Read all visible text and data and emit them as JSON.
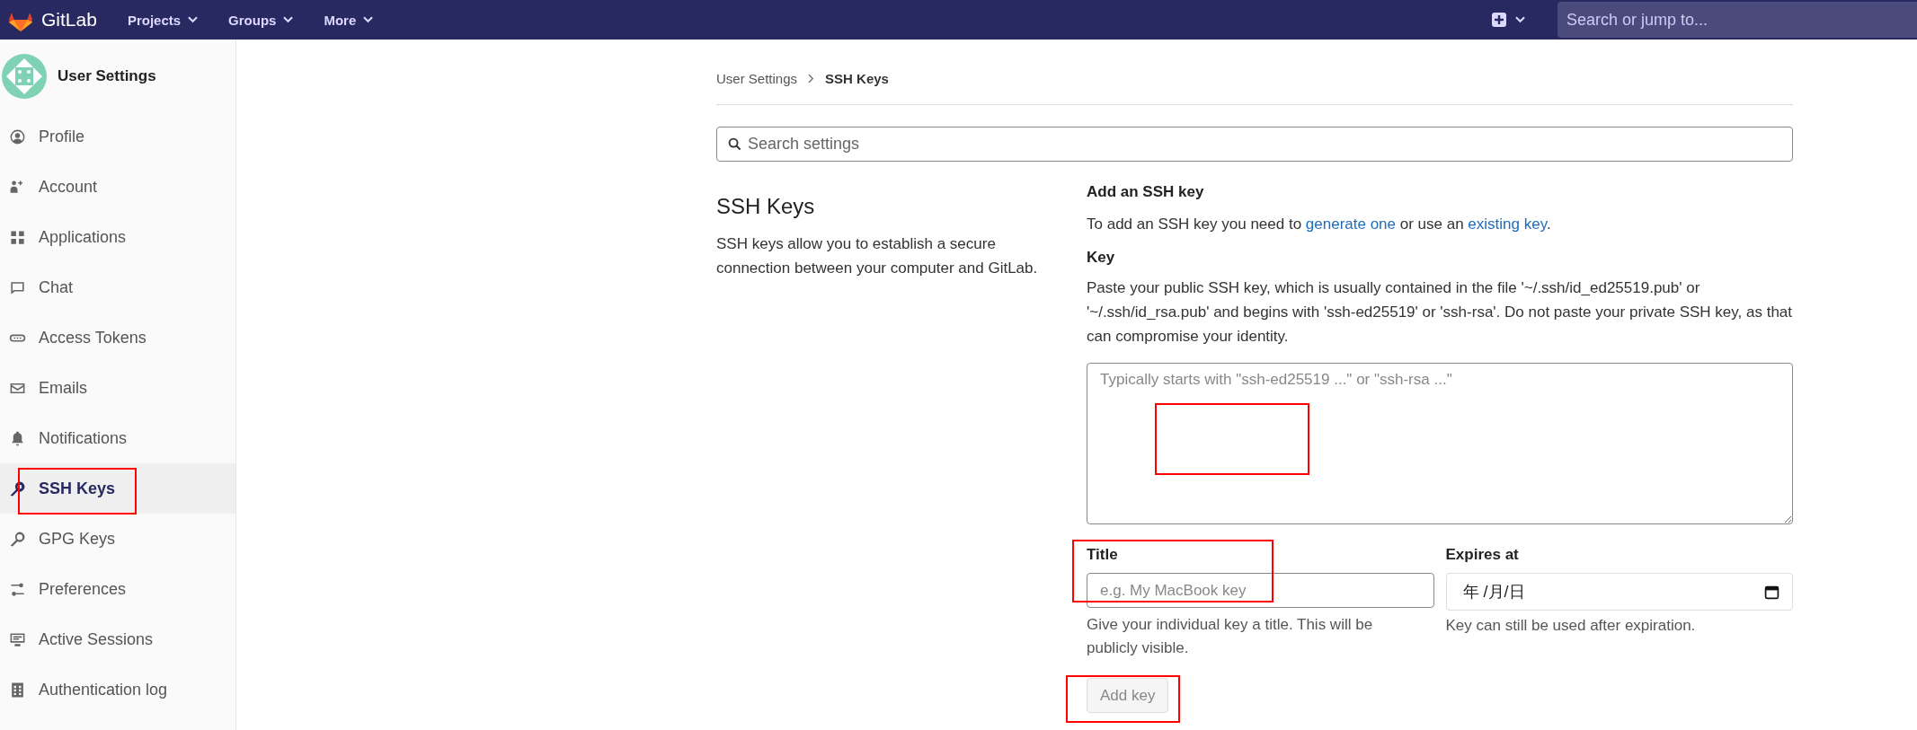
{
  "topbar": {
    "logo_text": "GitLab",
    "menus": [
      {
        "label": "Projects"
      },
      {
        "label": "Groups"
      },
      {
        "label": "More"
      }
    ],
    "search": {
      "placeholder": "Search or jump to..."
    }
  },
  "sidebar": {
    "title": "User Settings",
    "items": [
      {
        "label": "Profile",
        "selected": false
      },
      {
        "label": "Account",
        "selected": false
      },
      {
        "label": "Applications",
        "selected": false
      },
      {
        "label": "Chat",
        "selected": false
      },
      {
        "label": "Access Tokens",
        "selected": false
      },
      {
        "label": "Emails",
        "selected": false
      },
      {
        "label": "Notifications",
        "selected": false
      },
      {
        "label": "SSH Keys",
        "selected": true
      },
      {
        "label": "GPG Keys",
        "selected": false
      },
      {
        "label": "Preferences",
        "selected": false
      },
      {
        "label": "Active Sessions",
        "selected": false
      },
      {
        "label": "Authentication log",
        "selected": false
      }
    ]
  },
  "breadcrumb": [
    {
      "label": "User Settings"
    },
    {
      "label": "SSH Keys"
    }
  ],
  "search_settings": {
    "placeholder": "Search settings"
  },
  "section": {
    "title": "SSH Keys",
    "description": "SSH keys allow you to establish a secure connection between your computer and GitLab."
  },
  "form": {
    "heading": "Add an SSH key",
    "intro": [
      {
        "kind": "text",
        "text": "To add an SSH key you need to "
      },
      {
        "kind": "link",
        "text": "generate one"
      },
      {
        "kind": "text",
        "text": " or use an "
      },
      {
        "kind": "link",
        "text": "existing key"
      },
      {
        "kind": "text",
        "text": "."
      }
    ],
    "key_label": "Key",
    "key_help": "Paste your public SSH key, which is usually contained in the file '~/.ssh/id_ed25519.pub' or '~/.ssh/id_rsa.pub' and begins with 'ssh-ed25519' or 'ssh-rsa'. Do not paste your private SSH key, as that can compromise your identity.",
    "key_placeholder": "Typically starts with \"ssh-ed25519 ...\" or \"ssh-rsa ...\"",
    "title_label": "Title",
    "title_placeholder": "e.g. My MacBook key",
    "title_help": "Give your individual key a title. This will be publicly visible.",
    "expires_label": "Expires at",
    "expires_value": "年 /月/日",
    "expires_help": "Key can still be used after expiration.",
    "submit": {
      "label": "Add key",
      "disabled": true
    }
  }
}
